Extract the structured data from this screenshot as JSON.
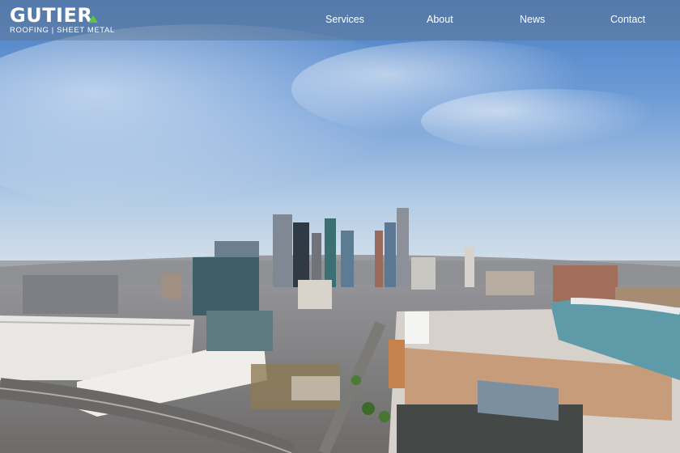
{
  "brand": {
    "name": "GUTIER",
    "tagline": "ROOFING | SHEET METAL",
    "accent_color": "#5ec63a"
  },
  "nav": {
    "items": [
      {
        "label": "Services"
      },
      {
        "label": "About"
      },
      {
        "label": "News"
      },
      {
        "label": "Contact"
      }
    ]
  },
  "hero": {
    "image_subject": "aerial-city-skyline-with-stadium"
  }
}
